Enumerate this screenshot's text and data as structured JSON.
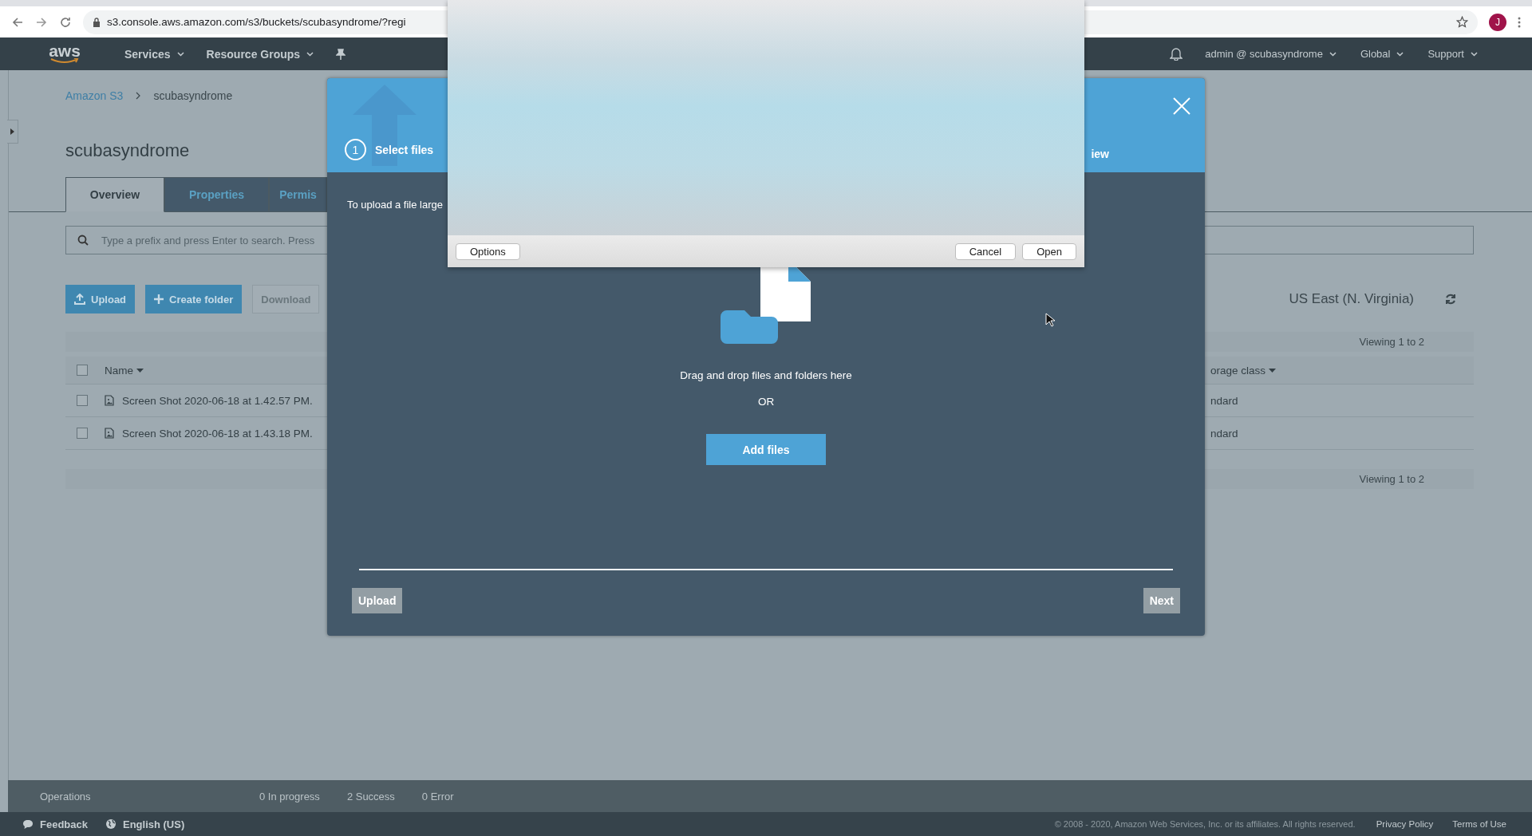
{
  "browser": {
    "url": "s3.console.aws.amazon.com/s3/buckets/scubasyndrome/?regi",
    "profile_initial": "J"
  },
  "nav": {
    "logo": "aws",
    "menus": [
      "Services",
      "Resource Groups"
    ],
    "right_menus": [
      "admin @ scubasyndrome",
      "Global",
      "Support"
    ]
  },
  "breadcrumb": [
    {
      "label": "Amazon S3",
      "kind": "link"
    },
    {
      "label": "scubasyndrome",
      "kind": "current"
    }
  ],
  "bucket_title": "scubasyndrome",
  "tabs": [
    {
      "label": "Overview",
      "selected": true
    },
    {
      "label": "Properties",
      "selected": false
    },
    {
      "label": "Permis",
      "selected": false
    }
  ],
  "search": {
    "placeholder": "Type a prefix and press Enter to search. Press"
  },
  "actions": [
    {
      "label": "Upload",
      "kind": "upload"
    },
    {
      "label": "Create folder",
      "kind": "create"
    },
    {
      "label": "Download",
      "kind": "disabled"
    }
  ],
  "region": "US East (N. Virginia)",
  "table": {
    "viewing_top": "Viewing 1 to 2",
    "select_all_checked": false,
    "columns": [
      "Name",
      "orage class"
    ],
    "rows": [
      {
        "name": "Screen Shot 2020-06-18 at 1.42.57 PM.",
        "storage_class": "ndard",
        "checked": false
      },
      {
        "name": "Screen Shot 2020-06-18 at 1.43.18 PM.",
        "storage_class": "ndard",
        "checked": false
      }
    ],
    "viewing_bottom": "Viewing 1 to 2"
  },
  "status_bar": {
    "label": "Operations",
    "counts": [
      "0 In progress",
      "2 Success",
      "0 Error"
    ]
  },
  "footer": {
    "feedback": "Feedback",
    "language": "English (US)",
    "copyright": "© 2008 - 2020, Amazon Web Services, Inc. or its affiliates. All rights reserved.",
    "links": [
      "Privacy Policy",
      "Terms of Use"
    ]
  },
  "upload_dialog": {
    "first_step": {
      "number": "1",
      "label": "Select files"
    },
    "last_step": {
      "label": "iew"
    },
    "note": "To upload a file large",
    "drop_text": "Drag and drop files and folders here",
    "or": "OR",
    "add_button": "Add files",
    "footer_buttons": [
      "Upload",
      "Next"
    ]
  },
  "file_picker": {
    "left_button": "Options",
    "right_buttons": [
      "Cancel",
      "Open"
    ]
  }
}
